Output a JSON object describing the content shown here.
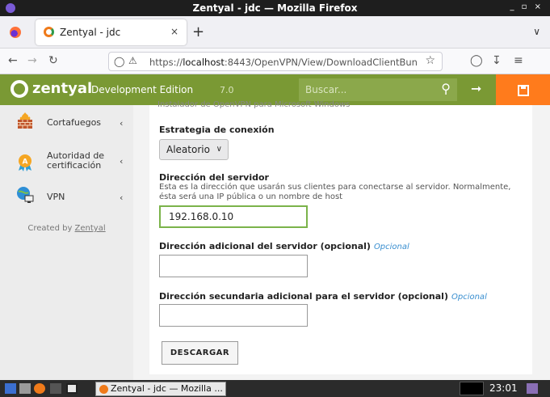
{
  "window": {
    "title": "Zentyal - jdc — Mozilla Firefox",
    "controls": "_ ▫ ×"
  },
  "browser": {
    "tab_title": "Zentyal - jdc",
    "tab_close": "×",
    "new_tab": "+",
    "url_prefix": "https://",
    "url_host": "localhost",
    "url_rest": ":8443/OpenVPN/View/DownloadClientBun"
  },
  "header": {
    "brand": "zentyal",
    "edition": "Development Edition",
    "version": "7.0",
    "search_placeholder": "Buscar..."
  },
  "sidebar": {
    "items": [
      {
        "label": "Cortafuegos",
        "icon": "firewall-icon"
      },
      {
        "label": "Autoridad de certificación",
        "icon": "certificate-icon"
      },
      {
        "label": "VPN",
        "icon": "vpn-icon"
      }
    ],
    "credit_prefix": "Created by ",
    "credit_link": "Zentyal"
  },
  "form": {
    "cut_text": "Instalador de OpenVPN para Microsoft Windows",
    "strategy_label": "Estrategia de conexión",
    "strategy_value": "Aleatorio",
    "server_label": "Dirección del servidor",
    "server_help": "Esta es la dirección que usarán sus clientes para conectarse al servidor. Normalmente, ésta será una IP pública o un nombre de host",
    "server_value": "192.168.0.10",
    "additional_label": "Dirección adicional del servidor (opcional)",
    "additional_value": "",
    "secondary_label": "Dirección secundaria adicional para el servidor (opcional)",
    "secondary_value": "",
    "optional_tag": "Opcional",
    "download_button": "DESCARGAR"
  },
  "taskbar": {
    "task_label": "Zentyal - jdc — Mozilla ...",
    "clock": "23:01"
  },
  "colors": {
    "zentyal_green": "#7a9934",
    "save_orange": "#ff7b1c",
    "optional_blue": "#3a8fd0",
    "focus_green": "#7bb34a"
  }
}
